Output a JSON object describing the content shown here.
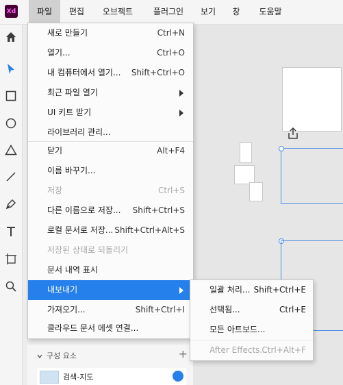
{
  "app": {
    "logo": "Xd"
  },
  "menubar": {
    "items": [
      {
        "label": "파일"
      },
      {
        "label": "편집"
      },
      {
        "label": "오브젝트"
      },
      {
        "label": "플러그인"
      },
      {
        "label": "보기"
      },
      {
        "label": "창"
      },
      {
        "label": "도움말"
      }
    ],
    "active": "파일"
  },
  "file_menu": {
    "items": [
      {
        "label": "새로 만들기",
        "shortcut": "Ctrl+N"
      },
      {
        "label": "열기...",
        "shortcut": "Ctrl+O"
      },
      {
        "label": "내 컴퓨터에서 열기...",
        "shortcut": "Shift+Ctrl+O"
      },
      {
        "label": "최근 파일 열기",
        "shortcut": ""
      },
      {
        "label": "UI 키트 받기",
        "shortcut": ""
      },
      {
        "label": "라이브러리 관리...",
        "shortcut": ""
      },
      {
        "label": "닫기",
        "shortcut": "Alt+F4"
      },
      {
        "label": "이름 바꾸기...",
        "shortcut": ""
      },
      {
        "label": "저장",
        "shortcut": "Ctrl+S"
      },
      {
        "label": "다른 이름으로 저장...",
        "shortcut": "Shift+Ctrl+S"
      },
      {
        "label": "로컬 문서로 저장...",
        "shortcut": "Shift+Ctrl+Alt+S"
      },
      {
        "label": "저장된 상태로 되돌리기",
        "shortcut": ""
      },
      {
        "label": "문서 내역 표시",
        "shortcut": ""
      },
      {
        "label": "내보내기",
        "shortcut": ""
      },
      {
        "label": "가져오기...",
        "shortcut": "Shift+Ctrl+I"
      },
      {
        "label": "클라우드 문서 에셋 연결...",
        "shortcut": ""
      }
    ],
    "highlighted": "내보내기",
    "disabled": [
      "저장",
      "저장된 상태로 되돌리기"
    ]
  },
  "export_submenu": {
    "items": [
      {
        "label": "일괄 처리...",
        "shortcut": "Shift+Ctrl+E"
      },
      {
        "label": "선택됨...",
        "shortcut": "Ctrl+E"
      },
      {
        "label": "모든 아트보드...",
        "shortcut": ""
      },
      {
        "label": "After Effects...",
        "shortcut": "Ctrl+Alt+F"
      }
    ],
    "disabled": [
      "After Effects..."
    ]
  },
  "toolbar": {
    "tools": [
      "home-icon",
      "select-icon",
      "rectangle-icon",
      "ellipse-icon",
      "polygon-icon",
      "line-icon",
      "pen-icon",
      "text-icon",
      "artboard-icon",
      "zoom-icon"
    ]
  },
  "assets_panel": {
    "section_title": "구성 요소",
    "item_label": "검색-지도"
  },
  "colors": {
    "accent": "#2680eb",
    "app_logo_bg": "#470137",
    "app_logo_fg": "#ff61f6",
    "selection": "#4a8ce6"
  }
}
